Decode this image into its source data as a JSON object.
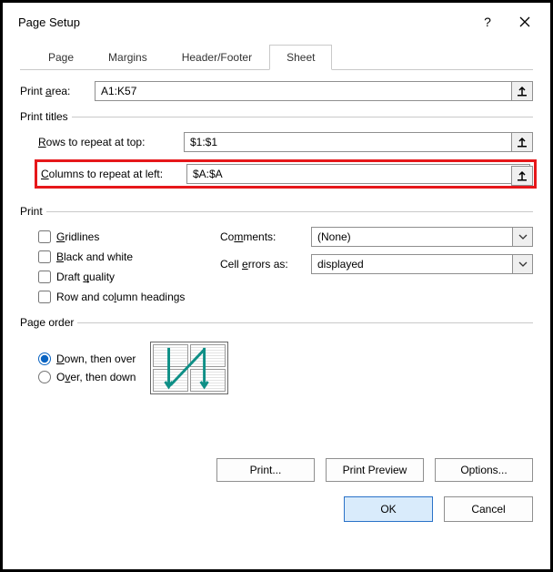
{
  "title": "Page Setup",
  "titlebar": {
    "help": "?"
  },
  "tabs": [
    "Page",
    "Margins",
    "Header/Footer",
    "Sheet"
  ],
  "print_area": {
    "label": "Print area:",
    "underline": "a",
    "value": "A1:K57"
  },
  "groups": {
    "print_titles": "Print titles",
    "print": "Print",
    "page_order": "Page order"
  },
  "rows_repeat": {
    "label": "Rows to repeat at top:",
    "value": "$1:$1"
  },
  "cols_repeat": {
    "label": "Columns to repeat at left:",
    "value": "$A:$A"
  },
  "checkboxes": {
    "gridlines": {
      "label": "Gridlines",
      "checked": false
    },
    "black_white": {
      "label": "Black and white",
      "checked": false
    },
    "draft_quality": {
      "label": "Draft quality",
      "checked": false
    },
    "row_col_headings": {
      "label": "Row and column headings",
      "checked": false
    }
  },
  "comments": {
    "label": "Comments:",
    "value": "(None)"
  },
  "cell_errors": {
    "label": "Cell errors as:",
    "value": "displayed"
  },
  "page_order": {
    "down_then_over": {
      "label": "Down, then over",
      "selected": true
    },
    "over_then_down": {
      "label": "Over, then down",
      "selected": false
    }
  },
  "buttons": {
    "print": "Print...",
    "preview": "Print Preview",
    "options": "Options...",
    "ok": "OK",
    "cancel": "Cancel"
  }
}
